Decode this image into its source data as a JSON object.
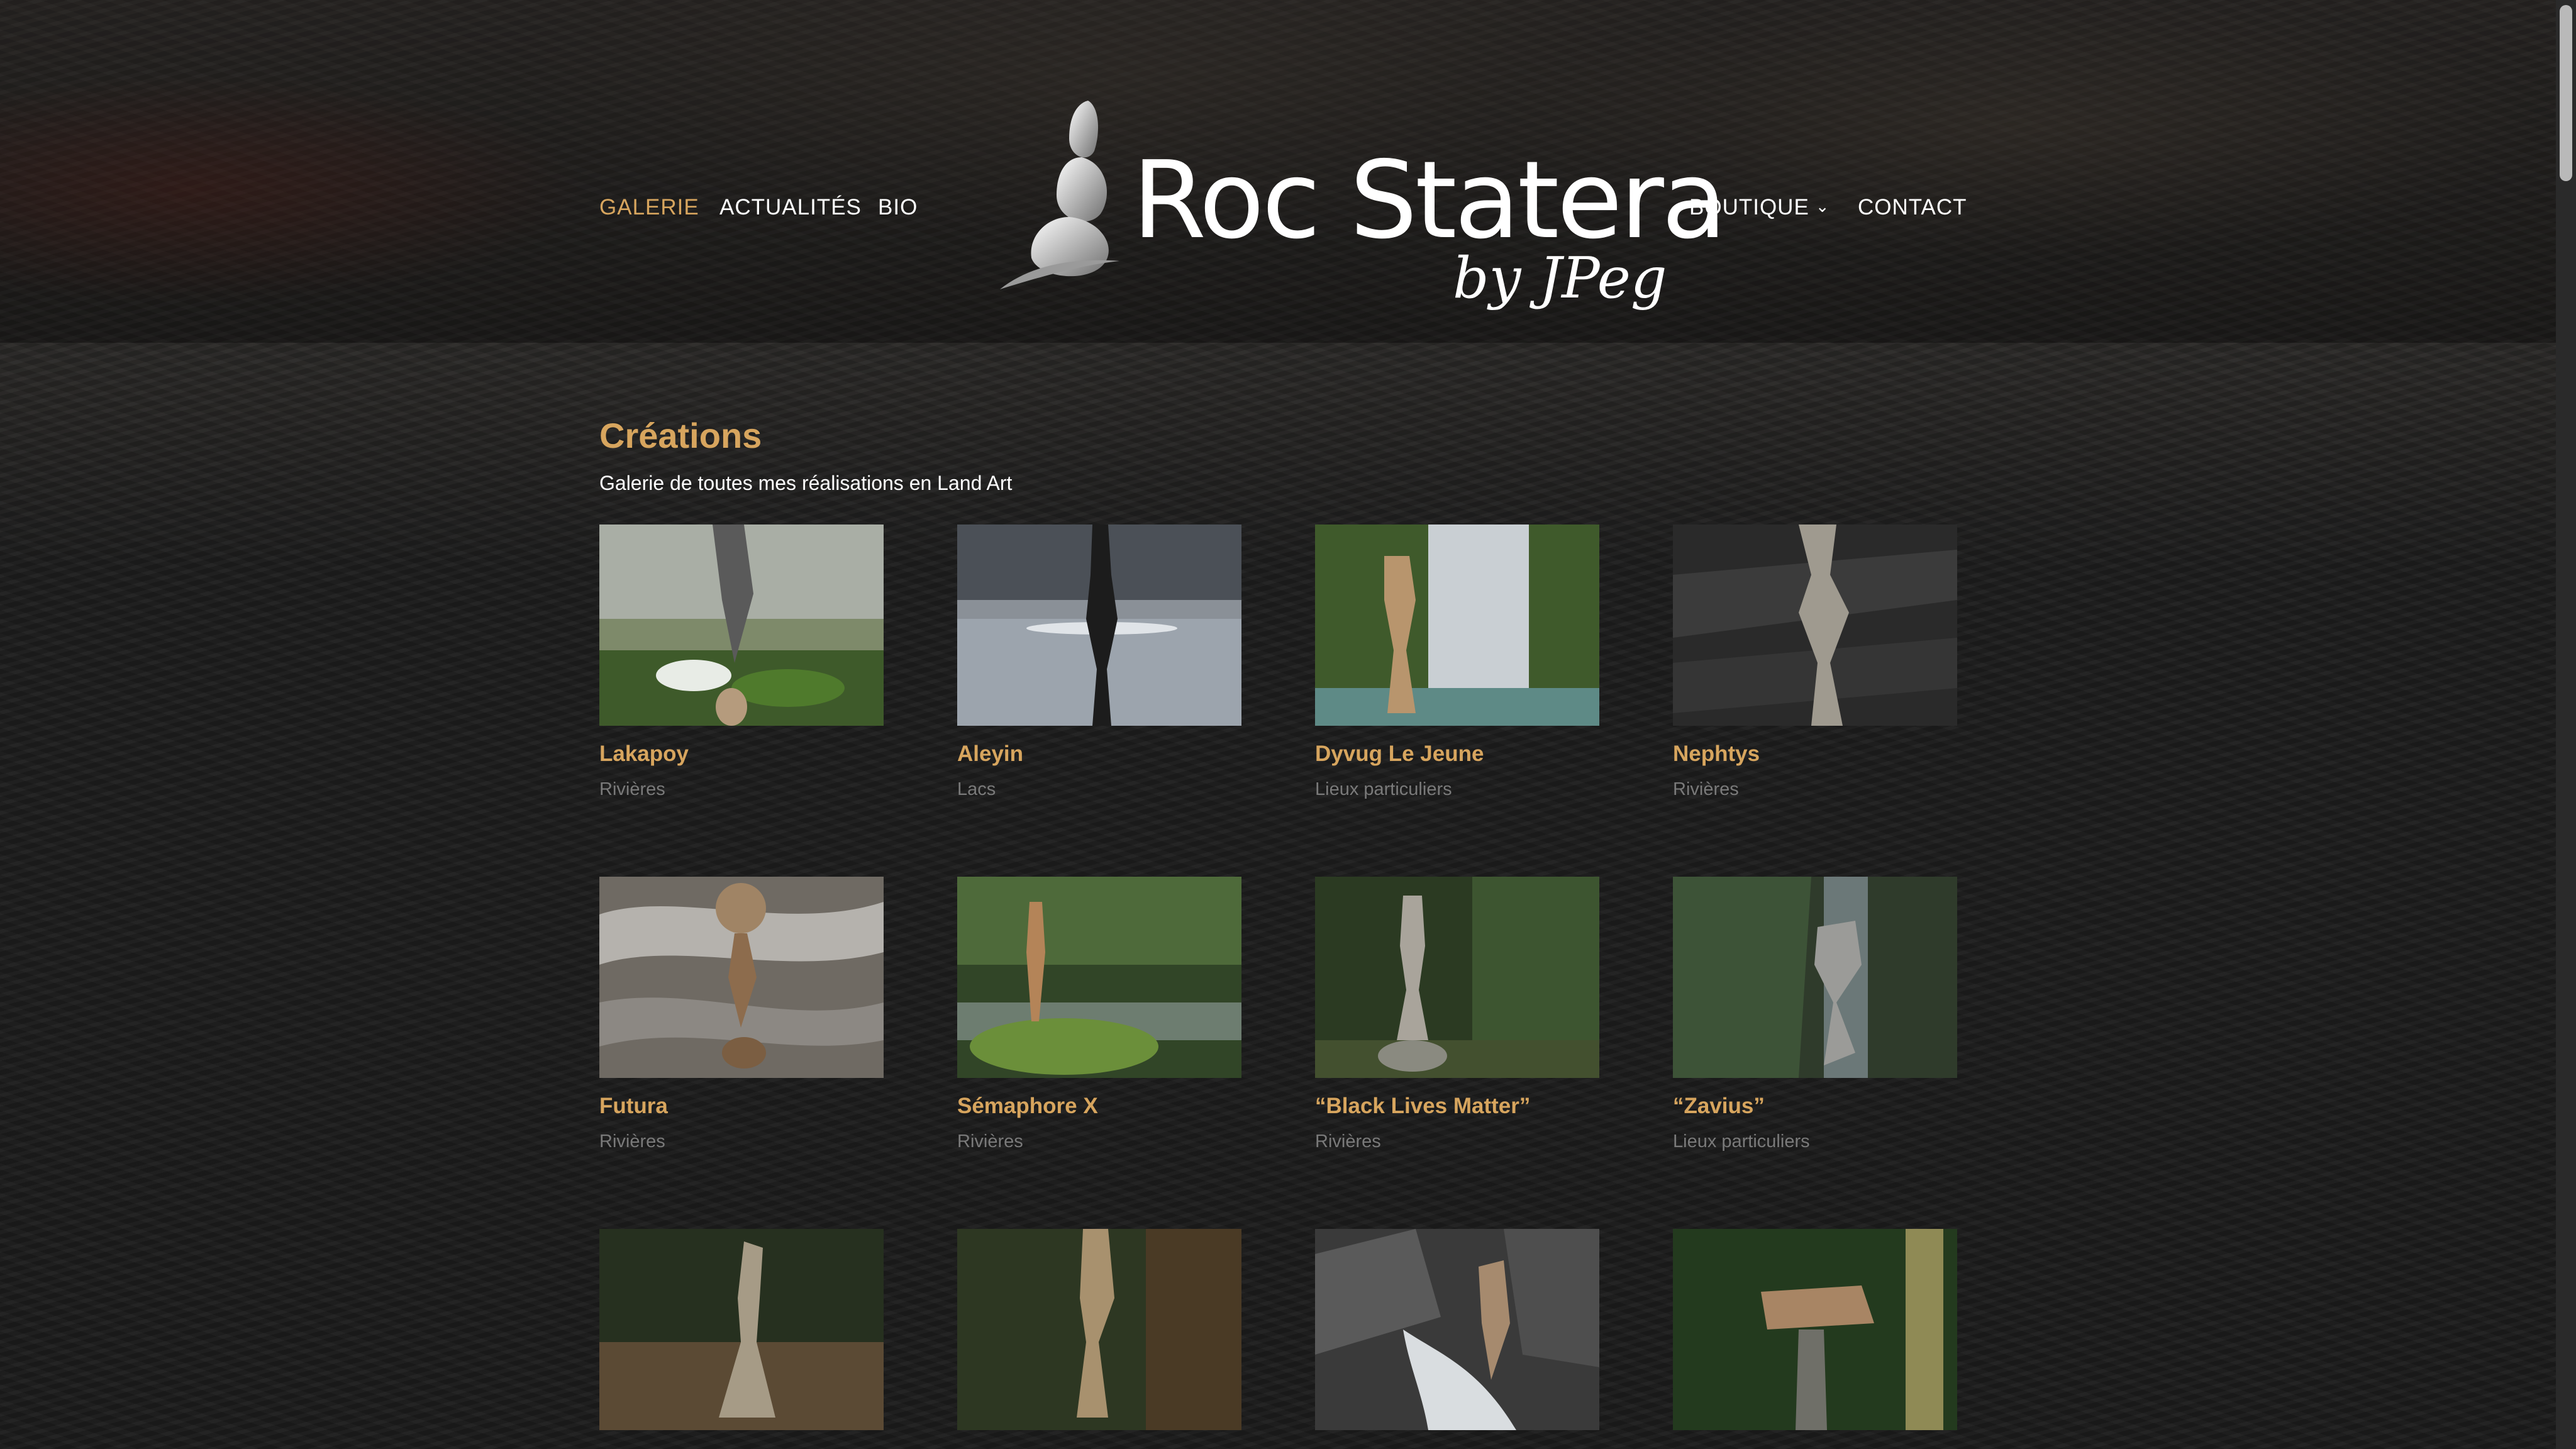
{
  "nav": {
    "left": [
      {
        "label": "GALERIE",
        "active": true
      },
      {
        "label": "ACTUALITÉS",
        "active": false
      },
      {
        "label": "BIO",
        "active": false
      }
    ],
    "right": [
      {
        "label": "BOUTIQUE",
        "has_dropdown": true
      },
      {
        "label": "CONTACT",
        "has_dropdown": false
      }
    ]
  },
  "logo": {
    "title": "Roc Statera",
    "subtitle": "by JPeg"
  },
  "page": {
    "title": "Créations",
    "subtitle": "Galerie de toutes mes réalisations en Land Art"
  },
  "gallery": [
    {
      "title": "Lakapoy",
      "category": "Rivières"
    },
    {
      "title": "Aleyin",
      "category": "Lacs"
    },
    {
      "title": "Dyvug Le Jeune",
      "category": "Lieux particuliers"
    },
    {
      "title": "Nephtys",
      "category": "Rivières"
    },
    {
      "title": "Futura",
      "category": "Rivières"
    },
    {
      "title": "Sémaphore X",
      "category": "Rivières"
    },
    {
      "title": "“Black Lives Matter”",
      "category": "Rivières"
    },
    {
      "title": "“Zavius”",
      "category": "Lieux particuliers"
    },
    {
      "title": "",
      "category": ""
    },
    {
      "title": "",
      "category": ""
    },
    {
      "title": "",
      "category": ""
    },
    {
      "title": "",
      "category": ""
    }
  ],
  "colors": {
    "accent": "#d7a55e",
    "background": "#1b1b1b",
    "muted": "#7a7a7a"
  }
}
